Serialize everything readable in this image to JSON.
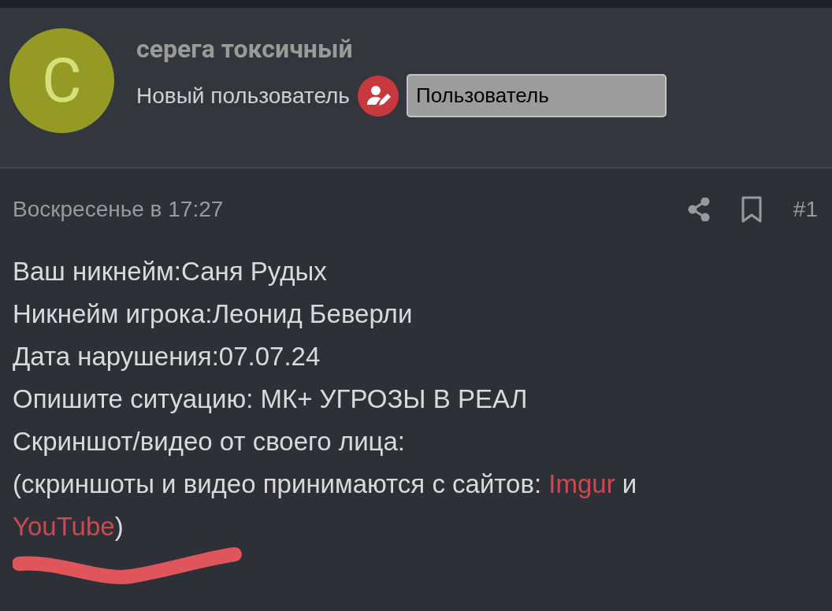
{
  "author": {
    "avatar_letter": "C",
    "name": "серега токсичный",
    "rank": "Новый пользователь",
    "role_badge": "Пользователь"
  },
  "post": {
    "date": "Воскресенье в 17:27",
    "number": "#1",
    "lines": [
      "Ваш никнейм:Саня Рудых",
      "Никнейм игрока:Леонид Беверли",
      "Дата нарушения:07.07.24",
      "Опишите ситуацию: МК+ УГРОЗЫ В РЕАЛ",
      "Скриншот/видео от своего лица:"
    ],
    "note": [
      {
        "kind": "text",
        "text": "(скриншоты и видео принимаются с сайтов: "
      },
      {
        "kind": "link",
        "text": "Imgur"
      },
      {
        "kind": "text",
        "text": " и "
      },
      {
        "kind": "link",
        "text": "YouTube"
      },
      {
        "kind": "text",
        "text": ")"
      }
    ],
    "redacted": true
  }
}
